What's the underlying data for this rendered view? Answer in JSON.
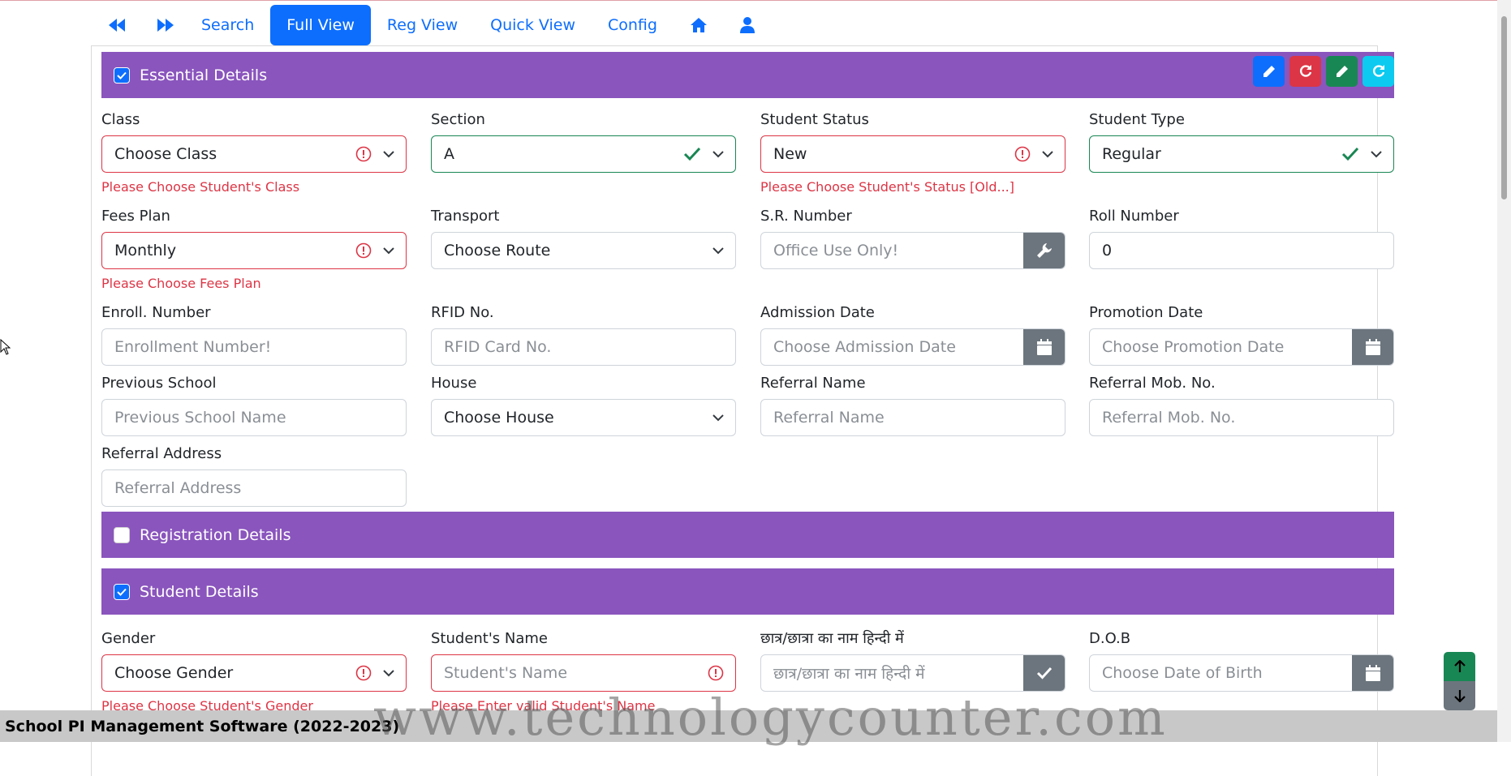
{
  "nav": {
    "prev_icon": "backward-icon",
    "next_icon": "forward-icon",
    "items": [
      "Search",
      "Full View",
      "Reg View",
      "Quick View",
      "Config"
    ],
    "active": "Full View",
    "home_icon": "home-icon",
    "user_icon": "user-icon"
  },
  "sections": {
    "essential": {
      "title": "Essential Details",
      "checked": true
    },
    "registration": {
      "title": "Registration Details",
      "checked": false
    },
    "student": {
      "title": "Student Details",
      "checked": true
    }
  },
  "toolbar": {
    "buttons": [
      {
        "icon": "pencil-icon",
        "color": "#0d6efd"
      },
      {
        "icon": "redo-icon",
        "color": "#dc3545"
      },
      {
        "icon": "pencil-icon",
        "color": "#198754"
      },
      {
        "icon": "refresh-icon",
        "color": "#0dcaf0"
      }
    ]
  },
  "fields": {
    "class": {
      "label": "Class",
      "value": "Choose Class",
      "error": "Please Choose Student's Class"
    },
    "section": {
      "label": "Section",
      "value": "A"
    },
    "student_status": {
      "label": "Student Status",
      "value": "New",
      "error": "Please Choose Student's Status [Old...]"
    },
    "student_type": {
      "label": "Student Type",
      "value": "Regular"
    },
    "fees_plan": {
      "label": "Fees Plan",
      "value": "Monthly",
      "error": "Please Choose Fees Plan"
    },
    "transport": {
      "label": "Transport",
      "value": "Choose Route"
    },
    "sr_number": {
      "label": "S.R. Number",
      "placeholder": "Office Use Only!"
    },
    "roll_number": {
      "label": "Roll Number",
      "value": "0"
    },
    "enroll_number": {
      "label": "Enroll. Number",
      "placeholder": "Enrollment Number!"
    },
    "rfid": {
      "label": "RFID No.",
      "placeholder": "RFID Card No."
    },
    "admission_date": {
      "label": "Admission Date",
      "placeholder": "Choose Admission Date"
    },
    "promotion_date": {
      "label": "Promotion Date",
      "placeholder": "Choose Promotion Date"
    },
    "previous_school": {
      "label": "Previous School",
      "placeholder": "Previous School Name"
    },
    "house": {
      "label": "House",
      "value": "Choose House"
    },
    "referral_name": {
      "label": "Referral Name",
      "placeholder": "Referral Name"
    },
    "referral_mob": {
      "label": "Referral Mob. No.",
      "placeholder": "Referral Mob. No."
    },
    "referral_address": {
      "label": "Referral Address",
      "placeholder": "Referral Address"
    },
    "gender": {
      "label": "Gender",
      "value": "Choose Gender",
      "error": "Please Choose Student's Gender"
    },
    "student_name": {
      "label": "Student's Name",
      "placeholder": "Student's Name",
      "error": "Please Enter valid Student's Name"
    },
    "hindi_name": {
      "label": "छात्र/छात्रा का नाम हिन्दी में",
      "placeholder": "छात्र/छात्रा का नाम हिन्दी में"
    },
    "dob": {
      "label": "D.O.B",
      "placeholder": "Choose Date of Birth"
    }
  },
  "footer": {
    "title": "School PI Management Software (2022-2023)"
  },
  "watermark": "www.technologycounter.com",
  "colors": {
    "section_bar": "#8a55bd",
    "primary": "#0d6efd",
    "danger": "#dc3545",
    "success": "#198754",
    "secondary": "#6c757d"
  }
}
